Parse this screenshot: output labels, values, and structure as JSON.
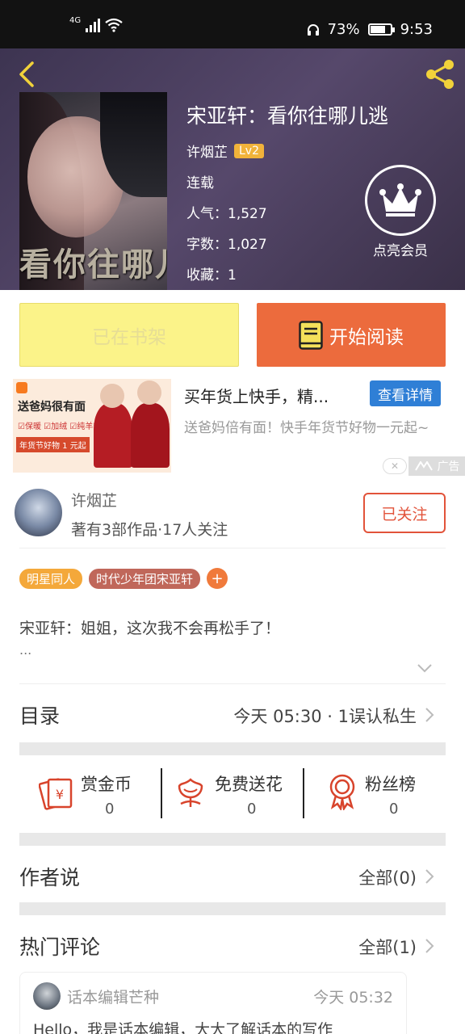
{
  "status_bar": {
    "network": "4G",
    "battery_percent": "73%",
    "battery_level": 0.73,
    "time": "9:53"
  },
  "book": {
    "title": "宋亚轩：看你往哪儿逃",
    "author": "许烟芷",
    "level": "Lv2",
    "status": "连载",
    "popularity": "人气：1,527",
    "word_count": "字数：1,027",
    "favorites": "收藏：1",
    "cover_caption": "看你往哪儿"
  },
  "vip": {
    "label": "点亮会员"
  },
  "actions": {
    "shelf_label": "已在书架",
    "read_label": "开始阅读"
  },
  "ad": {
    "image_headline": "送爸妈很有面",
    "image_features": "☑保暖 ☑加绒 ☑纯羊毛",
    "image_promo": "年货节好物 1 元起",
    "title": "买年货上快手，精...",
    "detail_button": "查看详情",
    "description": "送爸妈倍有面！快手年货节好物一元起~",
    "tag": "广告"
  },
  "author_card": {
    "name": "许烟芷",
    "stats": "著有3部作品·17人关注",
    "follow_label": "已关注"
  },
  "tags": [
    {
      "label": "明星同人",
      "color": "#f4a83a"
    },
    {
      "label": "时代少年团宋亚轩",
      "color": "#c0675a"
    }
  ],
  "intro": {
    "text": "宋亚轩：姐姐，这次我不会再松手了！",
    "more": "..."
  },
  "catalog": {
    "title": "目录",
    "latest": "今天 05:30 · 1误认私生"
  },
  "stats": [
    {
      "label": "赏金币",
      "value": "0",
      "icon": "reward-coin-icon"
    },
    {
      "label": "免费送花",
      "value": "0",
      "icon": "flower-icon"
    },
    {
      "label": "粉丝榜",
      "value": "0",
      "icon": "fan-ranking-medal-icon"
    }
  ],
  "author_says": {
    "title": "作者说",
    "link": "全部(0)"
  },
  "hot_comments": {
    "title": "热门评论",
    "link": "全部(1)"
  },
  "comment": {
    "user": "话本编辑芒种",
    "time": "今天 05:32",
    "text": "Hello，我是话本编辑，大大了解话本的写作"
  },
  "colors": {
    "accent": "#ec6b3d",
    "shelf_yellow": "#fbf389",
    "follow_red": "#e2533a",
    "lv_badge": "#f1b33a",
    "icon_red": "#d8442c"
  }
}
